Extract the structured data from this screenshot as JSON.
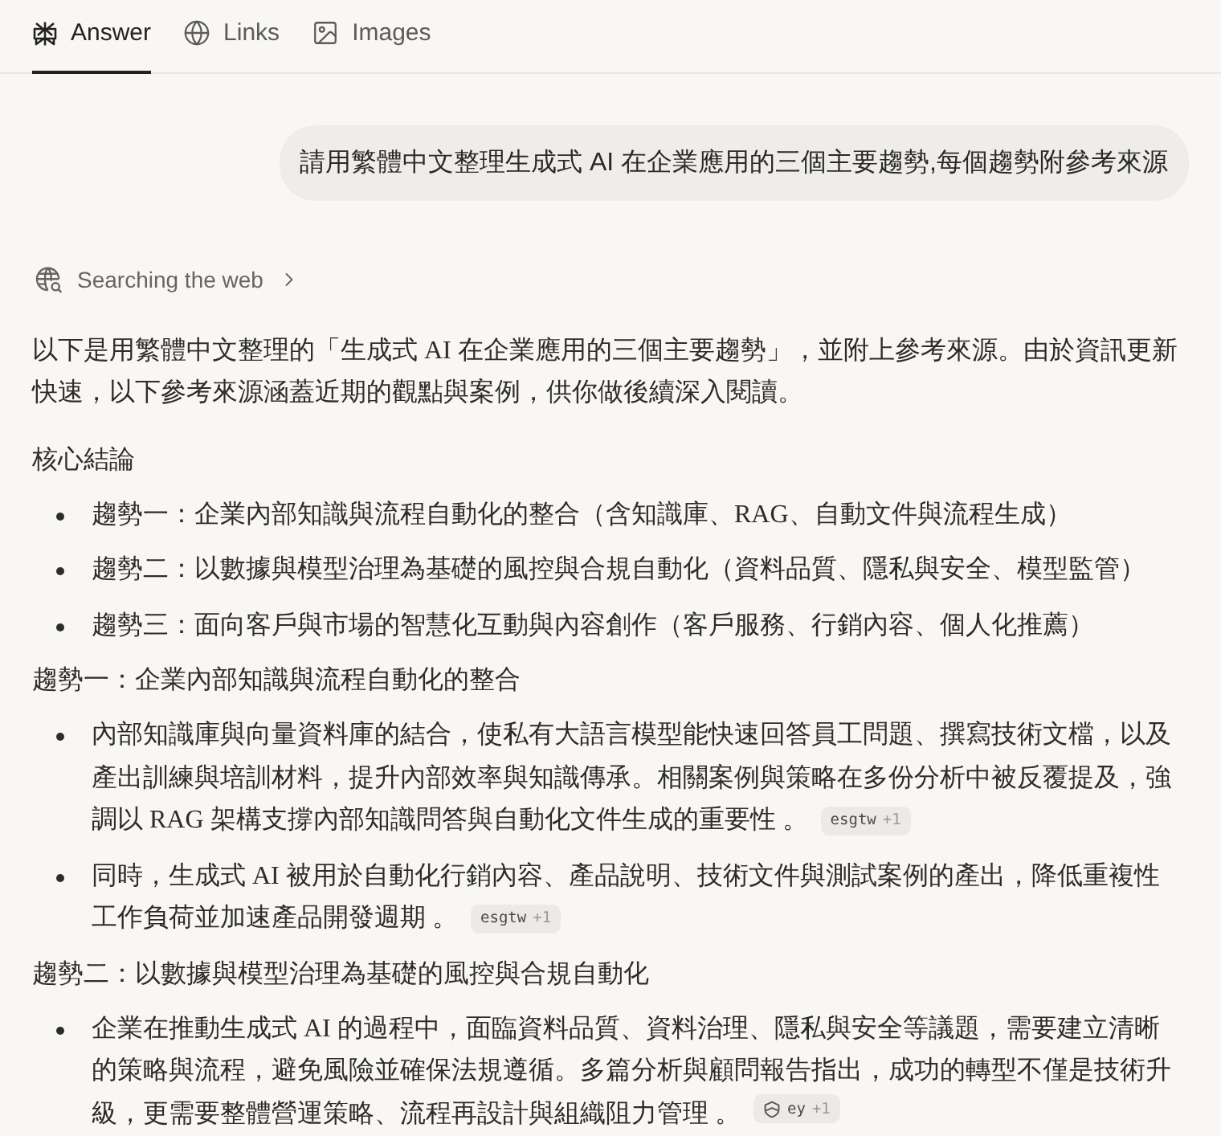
{
  "tabs": [
    {
      "label": "Answer",
      "selected": true
    },
    {
      "label": "Links",
      "selected": false
    },
    {
      "label": "Images",
      "selected": false
    }
  ],
  "user_message": "請用繁體中文整理生成式 AI 在企業應用的三個主要趨勢,每個趨勢附參考來源",
  "search_status": {
    "label": "Searching the web"
  },
  "answer": [
    {
      "kind": "paragraph",
      "text": "以下是用繁體中文整理的「生成式 AI 在企業應用的三個主要趨勢」，並附上參考來源。由於資訊更新快速，以下參考來源涵蓋近期的觀點與案例，供你做後續深入閱讀。"
    },
    {
      "kind": "heading",
      "text": "核心結論"
    },
    {
      "kind": "list",
      "items": [
        {
          "text": "趨勢一：企業內部知識與流程自動化的整合（含知識庫、RAG、自動文件與流程生成）"
        },
        {
          "text": "趨勢二：以數據與模型治理為基礎的風控與合規自動化（資料品質、隱私與安全、模型監管）"
        },
        {
          "text": "趨勢三：面向客戶與市場的智慧化互動與內容創作（客戶服務、行銷內容、個人化推薦）"
        }
      ]
    },
    {
      "kind": "heading",
      "text": "趨勢一：企業內部知識與流程自動化的整合"
    },
    {
      "kind": "list",
      "items": [
        {
          "text": "內部知識庫與向量資料庫的結合，使私有大語言模型能快速回答員工問題、撰寫技術文檔，以及產出訓練與培訓材料，提升內部效率與知識傳承。相關案例與策略在多份分析中被反覆提及，強調以 RAG 架構支撐內部知識問答與自動化文件生成的重要性 。",
          "citations": [
            {
              "source": "esgtw",
              "extra": "+1",
              "favicon": false
            }
          ]
        },
        {
          "text": "同時，生成式 AI 被用於自動化行銷內容、產品說明、技術文件與測試案例的產出，降低重複性工作負荷並加速產品開發週期 。",
          "citations": [
            {
              "source": "esgtw",
              "extra": "+1",
              "favicon": false
            }
          ]
        }
      ]
    },
    {
      "kind": "heading",
      "text": "趨勢二：以數據與模型治理為基礎的風控與合規自動化"
    },
    {
      "kind": "list",
      "items": [
        {
          "text": "企業在推動生成式 AI 的過程中，面臨資料品質、資料治理、隱私與安全等議題，需要建立清晰的策略與流程，避免風險並確保法規遵循。多篇分析與顧問報告指出，成功的轉型不僅是技術升級，更需要整體營運策略、流程再設計與組織阻力管理 。",
          "citations": [
            {
              "source": "ey",
              "extra": "+1",
              "favicon": true
            }
          ]
        }
      ]
    }
  ]
}
